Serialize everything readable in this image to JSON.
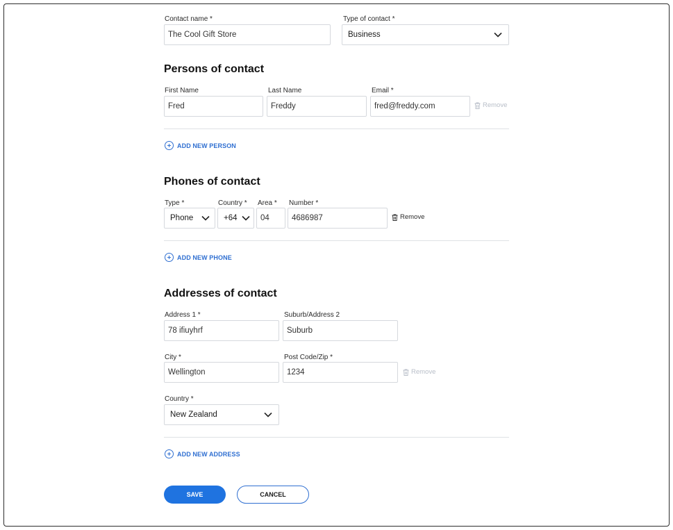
{
  "contact": {
    "name_label": "Contact name *",
    "name_value": "The Cool Gift Store",
    "type_label": "Type of contact *",
    "type_value": "Business"
  },
  "persons": {
    "title": "Persons of contact",
    "first_name_label": "First Name",
    "last_name_label": "Last Name",
    "email_label": "Email *",
    "first_name_value": "Fred",
    "last_name_value": "Freddy",
    "email_value": "fred@freddy.com",
    "remove_label": "Remove",
    "add_label": "ADD NEW PERSON"
  },
  "phones": {
    "title": "Phones of contact",
    "type_label": "Type *",
    "country_label": "Country *",
    "area_label": "Area *",
    "number_label": "Number *",
    "type_value": "Phone",
    "country_value": "+64",
    "area_value": "04",
    "number_value": "4686987",
    "remove_label": "Remove",
    "add_label": "ADD NEW PHONE"
  },
  "addresses": {
    "title": "Addresses of contact",
    "address1_label": "Address 1 *",
    "address2_label": "Suburb/Address 2",
    "city_label": "City *",
    "postcode_label": "Post Code/Zip *",
    "country_label": "Country *",
    "address1_value": "78 ifiuyhrf",
    "address2_value": "Suburb",
    "city_value": "Wellington",
    "postcode_value": "1234",
    "country_value": "New Zealand",
    "remove_label": "Remove",
    "add_label": "ADD NEW ADDRESS"
  },
  "actions": {
    "save_label": "SAVE",
    "cancel_label": "CANCEL"
  },
  "colors": {
    "accent": "#1f73e0",
    "link": "#2f6fd1",
    "disabled": "#b8bec8"
  }
}
